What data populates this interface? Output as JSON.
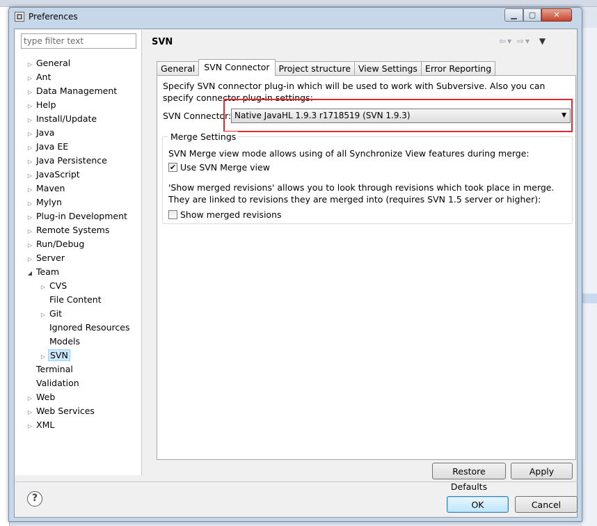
{
  "window": {
    "title": "Preferences"
  },
  "filter": {
    "placeholder": "type filter text"
  },
  "tree": [
    {
      "label": "General",
      "arrow": "closed",
      "indent": 0
    },
    {
      "label": "Ant",
      "arrow": "closed",
      "indent": 0
    },
    {
      "label": "Data Management",
      "arrow": "closed",
      "indent": 0
    },
    {
      "label": "Help",
      "arrow": "closed",
      "indent": 0
    },
    {
      "label": "Install/Update",
      "arrow": "closed",
      "indent": 0
    },
    {
      "label": "Java",
      "arrow": "closed",
      "indent": 0
    },
    {
      "label": "Java EE",
      "arrow": "closed",
      "indent": 0
    },
    {
      "label": "Java Persistence",
      "arrow": "closed",
      "indent": 0
    },
    {
      "label": "JavaScript",
      "arrow": "closed",
      "indent": 0
    },
    {
      "label": "Maven",
      "arrow": "closed",
      "indent": 0
    },
    {
      "label": "Mylyn",
      "arrow": "closed",
      "indent": 0
    },
    {
      "label": "Plug-in Development",
      "arrow": "closed",
      "indent": 0
    },
    {
      "label": "Remote Systems",
      "arrow": "closed",
      "indent": 0
    },
    {
      "label": "Run/Debug",
      "arrow": "closed",
      "indent": 0
    },
    {
      "label": "Server",
      "arrow": "closed",
      "indent": 0
    },
    {
      "label": "Team",
      "arrow": "open",
      "indent": 0
    },
    {
      "label": "CVS",
      "arrow": "closed",
      "indent": 1
    },
    {
      "label": "File Content",
      "arrow": "none",
      "indent": 1
    },
    {
      "label": "Git",
      "arrow": "closed",
      "indent": 1
    },
    {
      "label": "Ignored Resources",
      "arrow": "none",
      "indent": 1
    },
    {
      "label": "Models",
      "arrow": "none",
      "indent": 1
    },
    {
      "label": "SVN",
      "arrow": "closed",
      "indent": 1,
      "selected": true
    },
    {
      "label": "Terminal",
      "arrow": "none",
      "indent": 0
    },
    {
      "label": "Validation",
      "arrow": "none",
      "indent": 0
    },
    {
      "label": "Web",
      "arrow": "closed",
      "indent": 0
    },
    {
      "label": "Web Services",
      "arrow": "closed",
      "indent": 0
    },
    {
      "label": "XML",
      "arrow": "closed",
      "indent": 0
    }
  ],
  "page": {
    "title": "SVN",
    "tabs": [
      {
        "label": "General",
        "active": false
      },
      {
        "label": "SVN Connector",
        "active": true
      },
      {
        "label": "Project structure",
        "active": false
      },
      {
        "label": "View Settings",
        "active": false
      },
      {
        "label": "Error Reporting",
        "active": false
      }
    ],
    "description": "Specify SVN connector plug-in which will be used to work with Subversive. Also you can specify connector plug-in settings:",
    "connector_label": "SVN Connector:",
    "connector_value": "Native JavaHL 1.9.3 r1718519 (SVN 1.9.3)",
    "merge": {
      "legend": "Merge Settings",
      "desc": "SVN Merge view mode allows using of all Synchronize View features during merge:",
      "use_merge_view": {
        "label": "Use SVN Merge view",
        "checked": true
      },
      "show_desc": "'Show merged revisions' allows you to look through revisions which took place in merge. They are linked to revisions they are merged into (requires SVN 1.5 server or higher):",
      "show_merged": {
        "label": "Show merged revisions",
        "checked": false
      }
    }
  },
  "buttons": {
    "restore": "Restore Defaults",
    "apply": "Apply",
    "ok": "OK",
    "cancel": "Cancel"
  },
  "colors": {
    "highlight_box": "#e8262d",
    "selection": "#cce8ff"
  }
}
